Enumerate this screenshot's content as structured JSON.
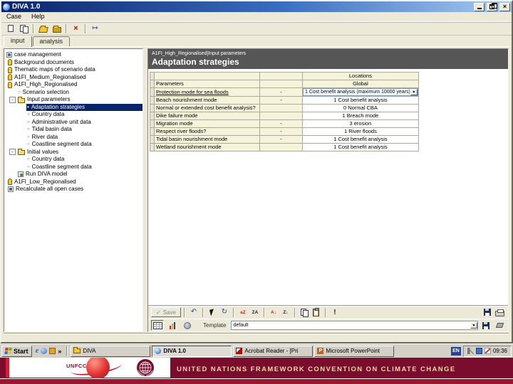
{
  "window": {
    "title": "DIVA 1.0"
  },
  "menu": {
    "items": [
      "Case",
      "Help"
    ]
  },
  "tabs": [
    {
      "label": "input",
      "active": true
    },
    {
      "label": "analysis",
      "active": false
    }
  ],
  "tree": {
    "items": [
      {
        "label": "case management",
        "level": 0,
        "icon": "case"
      },
      {
        "label": "Background documents",
        "level": 1,
        "icon": "lamp"
      },
      {
        "label": "Thematic maps of scenario data",
        "level": 1,
        "icon": "lamp"
      },
      {
        "label": "A1FI_Medium_Regionalised",
        "level": 1,
        "icon": "lamp"
      },
      {
        "label": "A1FI_High_Regionalised",
        "level": 1,
        "icon": "lamp"
      },
      {
        "label": "Scenario selection",
        "level": 2,
        "icon": "circle"
      },
      {
        "label": "Input parameters",
        "level": 2,
        "icon": "folder",
        "expand": "minus"
      },
      {
        "label": "Adaptation strategies",
        "level": 3,
        "icon": "dot",
        "selected": true
      },
      {
        "label": "Country data",
        "level": 3,
        "icon": "circle"
      },
      {
        "label": "Administrative unit data",
        "level": 3,
        "icon": "circle"
      },
      {
        "label": "Tidal basin data",
        "level": 3,
        "icon": "circle"
      },
      {
        "label": "River data",
        "level": 3,
        "icon": "circle"
      },
      {
        "label": "Coastline segment data",
        "level": 3,
        "icon": "circle"
      },
      {
        "label": "Initial values",
        "level": 2,
        "icon": "folder",
        "expand": "minus"
      },
      {
        "label": "Country data",
        "level": 3,
        "icon": "circle"
      },
      {
        "label": "Coastline segment data",
        "level": 3,
        "icon": "circle"
      },
      {
        "label": "Run DIVA model",
        "level": 2,
        "icon": "run"
      },
      {
        "label": "A1FI_Low_Regionalised",
        "level": 1,
        "icon": "lamp"
      },
      {
        "label": "Recalculate all open cases",
        "level": 1,
        "icon": "calc"
      }
    ]
  },
  "content": {
    "breadcrumb": "A1FI_High_Regionalised|Input parameters",
    "title": "Adaptation strategies"
  },
  "table": {
    "locations_header": "Locations",
    "parameters_header": "Parameters",
    "global_header": "Global",
    "rows": [
      {
        "parameter": "Protection mode for sea floods",
        "flag": "-",
        "value": "1 Cost benefit analysis (maximum 10000 years)",
        "dropdown": true,
        "selected": true
      },
      {
        "parameter": "Beach nourishment mode",
        "flag": "-",
        "value": "1 Cost benefit analysis"
      },
      {
        "parameter": "Normal or extended cost benefit analysis?",
        "flag": "",
        "value": "0 Normal CBA"
      },
      {
        "parameter": "Dike failure mode",
        "flag": "",
        "value": "1 Breach mode"
      },
      {
        "parameter": "Migration mode",
        "flag": "-",
        "value": "3 erosion"
      },
      {
        "parameter": "Respect river floods?",
        "flag": "-",
        "value": "1 River floods"
      },
      {
        "parameter": "Tidal basin nourishment mode",
        "flag": "-",
        "value": "1 Cost benefit analysis"
      },
      {
        "parameter": "Wetland nourishment mode",
        "flag": "",
        "value": "1 Cost benefit analysis"
      }
    ]
  },
  "actions": {
    "save_label": "Save"
  },
  "template_bar": {
    "label": "Template",
    "value": "default"
  },
  "taskbar": {
    "start_label": "Start",
    "windows": [
      {
        "label": "DIVA",
        "icon": "folder"
      },
      {
        "label": "DIVA 1.0",
        "icon": "diva",
        "active": true
      },
      {
        "label": "Acrobat Reader - [Pri",
        "icon": "acrobat"
      },
      {
        "label": "Microsoft PowerPoint",
        "icon": "powerpoint",
        "glyph": "P"
      }
    ],
    "tray": {
      "language": "EN",
      "time": "09:36"
    }
  },
  "banner": {
    "logo_text": "UNFCCC",
    "text": "UNITED NATIONS FRAMEWORK CONVENTION ON CLIMATE CHANGE"
  },
  "icons": {
    "close": "×",
    "check": "✓",
    "delete": "×",
    "export": "↦",
    "undo": "↶",
    "refresh": "↻",
    "sort_fill_az": "aZ",
    "sort_fill_za": "ZA",
    "sort_asc": "A↓",
    "sort_desc": "Z↓",
    "warning": "!",
    "chevron_down": "▼",
    "overflow": "»",
    "collapse": "-",
    "ie": "e",
    "bullet": "•",
    "circle": "○"
  },
  "colors": {
    "titlebar_start": "#0a246a",
    "titlebar_end": "#a6caf0",
    "selection": "#0a246a",
    "panel_header": "#565656",
    "cell_yellow": "#f5f3da",
    "banner_maroon": "#7a0d2d",
    "banner_stripe": "#99182f",
    "banner_text_gold": "#edd9a0",
    "delete_red": "#cc0000"
  }
}
